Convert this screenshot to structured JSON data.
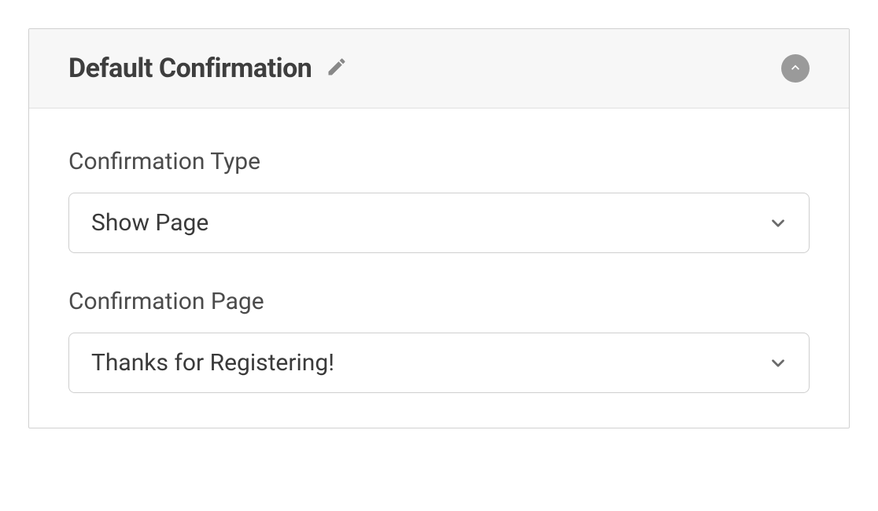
{
  "panel": {
    "title": "Default Confirmation",
    "fields": [
      {
        "label": "Confirmation Type",
        "value": "Show Page"
      },
      {
        "label": "Confirmation Page",
        "value": "Thanks for Registering!"
      }
    ]
  }
}
